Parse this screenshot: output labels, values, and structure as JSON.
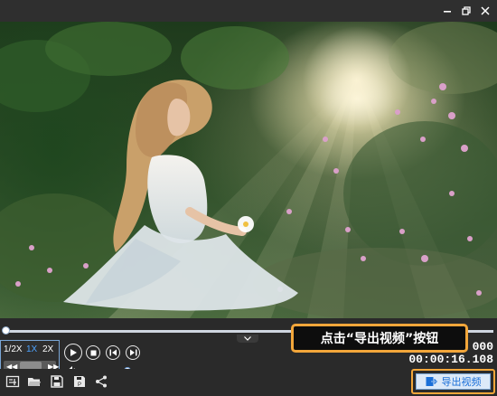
{
  "window": {
    "minimize_icon": "minimize-icon",
    "restore_icon": "restore-icon",
    "close_icon": "close-icon"
  },
  "playback": {
    "progress_fraction": 0.002,
    "speeds": [
      "1/2X",
      "1X",
      "2X"
    ],
    "active_speed": "1X",
    "volume_fraction": 0.95,
    "time_top": "000",
    "time_bottom": "00:00:16.108"
  },
  "toolbar": {
    "icons": [
      "snapshot-icon",
      "folder-open-icon",
      "save-icon",
      "save-as-icon",
      "share-icon"
    ]
  },
  "export": {
    "label": "导出视频"
  },
  "callout": {
    "text": "点击“导出视频”按钮"
  },
  "colors": {
    "accent": "#4da3ff",
    "highlight": "#f2a63a",
    "background": "#2b2b2b"
  }
}
